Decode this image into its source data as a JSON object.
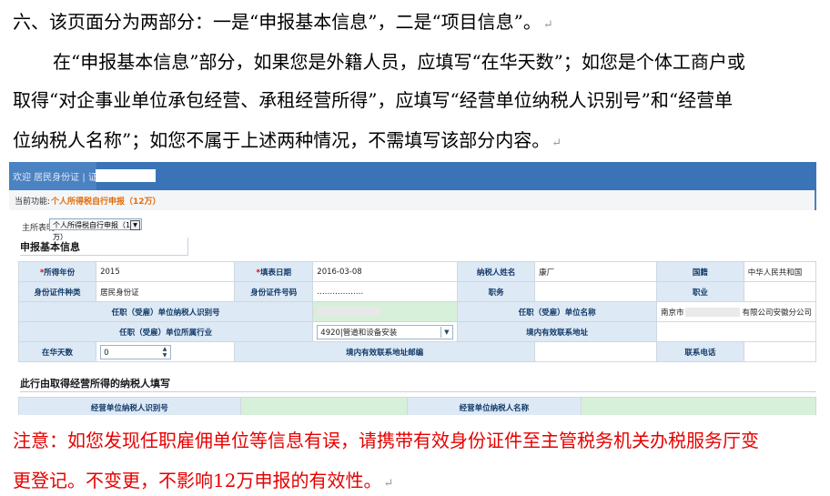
{
  "doc": {
    "p1": "六、该页面分为两部分：一是“申报基本信息”，二是“项目信息”。",
    "p2": "在“申报基本信息”部分，如果您是外籍人员，应填写“在华天数”；如您是个体工商户或",
    "p3": "取得“对企事业单位承包经营、承租经营所得”，应填写“经营单位纳税人识别号”和“经营单",
    "p4": "位纳税人名称”；如您不属于上述两种情况，不需填写该部分内容。",
    "note1": "注意：如您发现任职雇佣单位等信息有误，请携带有效身份证件至主管税务机关办税服务厅变",
    "note2": "更登记。不变更，不影响12万申报的有效性。",
    "para_mark": "↵",
    "note_color": "#e60000"
  },
  "screenshot": {
    "header_text": "欢迎 居民身份证 | 证件号码:",
    "crumb_label": "当前功能:",
    "crumb_value": "个人所得税自行申报（12万）",
    "select_label": "主所表明",
    "select_value": "个人所得税自行申报（12万）",
    "section1": "申报基本信息",
    "section2": "此行由取得经营所得的纳税人填写",
    "fields": {
      "year_label": "所得年份",
      "year_value": "2015",
      "date_label": "填表日期",
      "date_value": "2016-03-08",
      "name_label": "纳税人姓名",
      "name_value": "康厂",
      "country_label": "国籍",
      "country_value": "中华人民共和国",
      "idtype_label": "身份证件种类",
      "idtype_value": "居民身份证",
      "idno_label": "身份证件号码",
      "idno_value": "………………",
      "duty_label": "职务",
      "job_label": "职业",
      "emp_taxid_label": "任职（受雇）单位纳税人识别号",
      "emp_name_label": "任职（受雇）单位名称",
      "emp_name_prefix": "南京市",
      "emp_name_suffix": "有限公司安徽分公司",
      "emp_industry_label": "任职（受雇）单位所属行业",
      "emp_industry_value": "4920|管道和设备安装",
      "domestic_addr_label": "境内有效联系地址",
      "days_label": "在华天数",
      "days_value": "0",
      "zip_label": "境内有效联系地址邮编",
      "phone_label": "联系电话",
      "biz_taxid_label": "经营单位纳税人识别号",
      "biz_name_label": "经营单位纳税人名称"
    },
    "colors": {
      "header_bg": "#3b74b6",
      "label_bg": "#dde9f4",
      "label_text": "#123a6a",
      "input_green": "#d7f0d9",
      "crumb_value": "#e36c0a",
      "required_star": "#e00000"
    }
  }
}
